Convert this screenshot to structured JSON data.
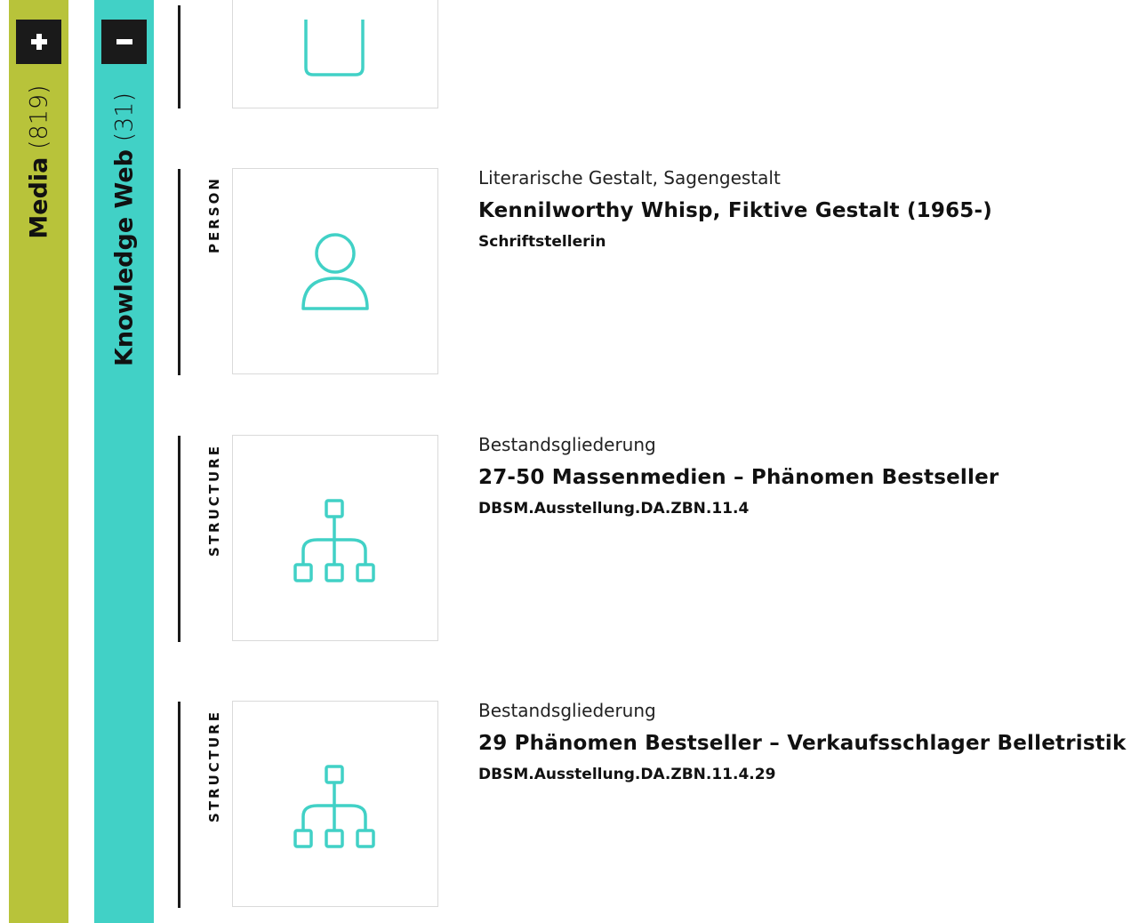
{
  "colors": {
    "media_panel": "#b8c33a",
    "knowledge_web_panel": "#41d1c6",
    "icon_stroke": "#41d1c6",
    "button_bg": "#1a1a1a"
  },
  "panels": {
    "media": {
      "label": "Media",
      "count": "(819)",
      "toggle_icon": "plus-icon"
    },
    "knowledge_web": {
      "label": "Knowledge Web",
      "count": "(31)",
      "toggle_icon": "minus-icon"
    }
  },
  "items": [
    {
      "type": "",
      "icon": "placeholder-icon"
    },
    {
      "type": "PERSON",
      "icon": "person-icon",
      "category": "Literarische Gestalt, Sagengestalt",
      "title": "Kennilworthy Whisp, Fiktive Gestalt (1965-)",
      "subtitle": "Schriftstellerin"
    },
    {
      "type": "STRUCTURE",
      "icon": "hierarchy-icon",
      "category": "Bestandsgliederung",
      "title": "27-50 Massenmedien – Phänomen Bestseller",
      "subtitle": "DBSM.Ausstellung.DA.ZBN.11.4"
    },
    {
      "type": "STRUCTURE",
      "icon": "hierarchy-icon",
      "category": "Bestandsgliederung",
      "title": "29 Phänomen Bestseller – Verkaufsschlager Belletristik",
      "subtitle": "DBSM.Ausstellung.DA.ZBN.11.4.29"
    }
  ]
}
